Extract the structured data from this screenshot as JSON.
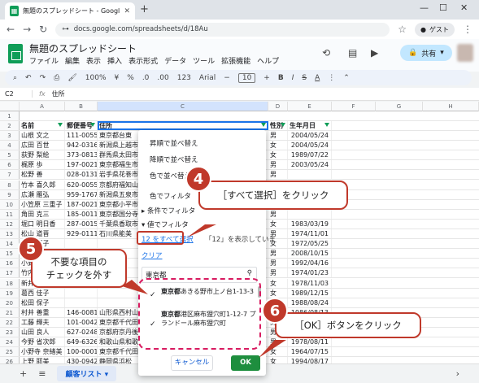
{
  "browser": {
    "tab_title": "無題のスプレッドシート - Google ス",
    "url": "docs.google.com/spreadsheets/d/18Au",
    "guest_label": "ゲスト"
  },
  "app": {
    "doc_title": "無題のスプレッドシート",
    "menus": [
      "ファイル",
      "編集",
      "表示",
      "挿入",
      "表示形式",
      "データ",
      "ツール",
      "拡張機能",
      "ヘルプ"
    ],
    "share_label": "共有"
  },
  "toolbar": {
    "zoom": "100%",
    "currency": "¥",
    "percent": "%",
    "dec1": ".0",
    "dec2": ".00",
    "format123": "123",
    "font": "Arial",
    "font_size": "10"
  },
  "formula_bar": {
    "cell_ref": "C2",
    "fx": "fx",
    "content": "住所"
  },
  "columns": [
    "A",
    "B",
    "C",
    "D",
    "E",
    "F",
    "G",
    "H"
  ],
  "header": {
    "row": "2",
    "name": "名前",
    "zip": "郵便番号",
    "address": "住所",
    "sex": "性別",
    "birthday": "生年月日"
  },
  "rows": [
    {
      "n": "3",
      "name": "山根 文之",
      "zip": "111-0055",
      "addr": "東京都台東",
      "sex": "男",
      "bday": "2004/05/24"
    },
    {
      "n": "4",
      "name": "広田 百世",
      "zip": "942-0316",
      "addr": "新潟県上越市",
      "sex": "女",
      "bday": "2004/05/24"
    },
    {
      "n": "5",
      "name": "荻野 梨絵",
      "zip": "373-0813",
      "addr": "群馬県太田市",
      "sex": "女",
      "bday": "1989/07/22"
    },
    {
      "n": "6",
      "name": "梶原 歩",
      "zip": "197-0021",
      "addr": "東京都福生市",
      "sex": "男",
      "bday": "2003/05/24"
    },
    {
      "n": "7",
      "name": "松野 善",
      "zip": "028-0131",
      "addr": "岩手県花巻市",
      "sex": "男",
      "bday": ""
    },
    {
      "n": "8",
      "name": "竹本 喜久郎",
      "zip": "620-0055",
      "addr": "京都府福知山",
      "sex": "男",
      "bday": ""
    },
    {
      "n": "9",
      "name": "広瀬 雁弘",
      "zip": "959-1767",
      "addr": "新潟県五泉市",
      "sex": "男",
      "bday": ""
    },
    {
      "n": "10",
      "name": "小笠原 三重子",
      "zip": "187-0021",
      "addr": "東京都小平市",
      "sex": "女",
      "bday": ""
    },
    {
      "n": "11",
      "name": "角田 克三",
      "zip": "185-0011",
      "addr": "東京都国分寺",
      "sex": "男",
      "bday": ""
    },
    {
      "n": "12",
      "name": "堀口 明日香",
      "zip": "287-0015",
      "addr": "千葉県香取市",
      "sex": "女",
      "bday": "1983/03/19"
    },
    {
      "n": "13",
      "name": "松山 道晋",
      "zip": "929-0111",
      "addr": "石川県能美",
      "sex": "男",
      "bday": "1974/11/01"
    },
    {
      "n": "14",
      "name": "大熊 鷹子",
      "zip": "",
      "addr": "",
      "sex": "女",
      "bday": "1972/05/25"
    },
    {
      "n": "15",
      "name": "大熊 国吉",
      "zip": "",
      "addr": "",
      "sex": "男",
      "bday": "2008/10/15"
    },
    {
      "n": "16",
      "name": "小野 恒男",
      "zip": "",
      "addr": "",
      "sex": "男",
      "bday": "1992/04/16"
    },
    {
      "n": "17",
      "name": "竹内 勇喜",
      "zip": "",
      "addr": "",
      "sex": "男",
      "bday": "1974/01/23"
    },
    {
      "n": "18",
      "name": "新井 美香",
      "zip": "",
      "addr": "",
      "sex": "女",
      "bday": "1978/11/03"
    },
    {
      "n": "19",
      "name": "葛西 佳子",
      "zip": "",
      "addr": "",
      "sex": "女",
      "bday": "1989/12/15"
    },
    {
      "n": "20",
      "name": "松田 保子",
      "zip": "",
      "addr": "",
      "sex": "女",
      "bday": "1988/08/24"
    },
    {
      "n": "21",
      "name": "村井 善重",
      "zip": "146-0081",
      "addr": "山形県西村山",
      "sex": "男",
      "bday": "1986/08/13"
    },
    {
      "n": "22",
      "name": "工藤 輝夫",
      "zip": "101-0042",
      "addr": "東京都千代田",
      "sex": "男",
      "bday": "1975/02/01"
    },
    {
      "n": "23",
      "name": "山田 良人",
      "zip": "627-0248",
      "addr": "京都府京丹後",
      "sex": "男",
      "bday": "1974/09/29"
    },
    {
      "n": "24",
      "name": "今野 省次郎",
      "zip": "649-6326",
      "addr": "和歌山県和歌",
      "sex": "男",
      "bday": "1978/08/11"
    },
    {
      "n": "25",
      "name": "小野寺 奈緒美",
      "zip": "100-0001",
      "addr": "東京都千代田",
      "sex": "女",
      "bday": "1964/07/15"
    },
    {
      "n": "26",
      "name": "上野 耶美",
      "zip": "430-0942",
      "addr": "静岡県浜松",
      "sex": "女",
      "bday": "1994/08/17"
    },
    {
      "n": "27",
      "name": "鈴木 星則",
      "zip": "965-0102",
      "addr": "福島県会津若",
      "sex": "男",
      "bday": "1976/08/17"
    }
  ],
  "filter": {
    "sort_asc": "昇順で並べ替え",
    "sort_desc": "降順で並べ替え",
    "sort_color": "色で並べ替え",
    "filter_color": "色でフィルタ",
    "filter_cond": "条件でフィルタ",
    "filter_value": "値でフィルタ",
    "select_all": "12 をすべて選択",
    "showing": "「12」を表示していま",
    "clear": "クリア",
    "search_value": "東京都",
    "values": [
      {
        "bold": "東京都",
        "rest": "あきる野市上ノ台1-13-3"
      },
      {
        "bold": "東京都",
        "rest": "港区麻布狸穴町1-12-7 プランドール麻布狸穴町"
      }
    ],
    "cancel": "キャンセル",
    "ok": "OK"
  },
  "sheet": {
    "tab_label": "顧客リスト"
  },
  "annotations": {
    "step4_num": "4",
    "step4_text": "［すべて選択］をクリック",
    "step5_num": "5",
    "step5_text1": "不要な項目の",
    "step5_text2": "チェックを外す",
    "step6_num": "6",
    "step6_text": "［OK］ボタンをクリック"
  }
}
